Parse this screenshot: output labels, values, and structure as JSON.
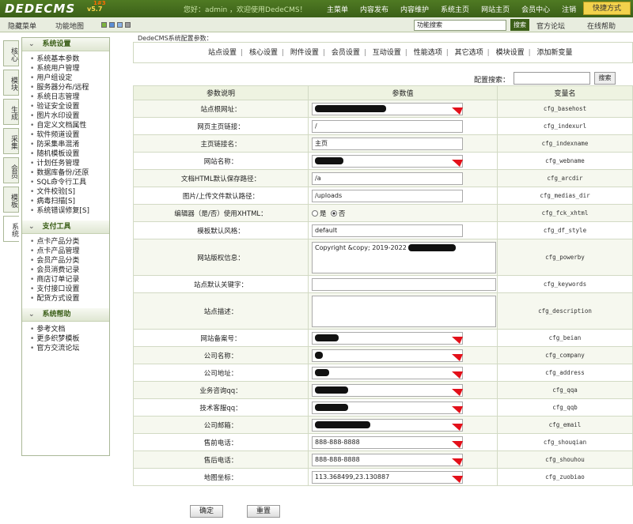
{
  "header": {
    "logo": "DEDECMS",
    "version": "v5.7",
    "badge": "1#3",
    "greeting": "您好：admin ，欢迎使用DedeCMS！",
    "nav": [
      "主菜单",
      "内容发布",
      "内容维护",
      "系统主页",
      "网站主页",
      "会员中心",
      "注销"
    ],
    "shortcut": "快捷方式"
  },
  "subbar": {
    "hide_menu": "隐藏菜单",
    "site_map": "功能地图",
    "search_value": "功能搜索",
    "search_button": "搜索",
    "forum": "官方论坛",
    "help": "在线帮助"
  },
  "vtabs": [
    "核心",
    "模块",
    "生成",
    "采集",
    "会员",
    "模板",
    "系统"
  ],
  "sidebar": {
    "sections": [
      {
        "title": "系统设置",
        "items": [
          "系统基本参数",
          "系统用户管理",
          "用户组设定",
          "服务器分布/远程",
          "系统日志管理",
          "验证安全设置",
          "图片水印设置",
          "自定义文档属性",
          "软件频道设置",
          "防采集串混淆",
          "随机模板设置",
          "计划任务管理",
          "数据库备份/还原",
          "SQL命令行工具",
          "文件校验[S]",
          "病毒扫描[S]",
          "系统错误修复[S]"
        ]
      },
      {
        "title": "支付工具",
        "items": [
          "点卡产品分类",
          "点卡产品管理",
          "会员产品分类",
          "会员消费记录",
          "商店订单记录",
          "支付接口设置",
          "配货方式设置"
        ]
      },
      {
        "title": "系统帮助",
        "items": [
          "参考文档",
          "更多织梦模板",
          "官方交流论坛"
        ]
      }
    ]
  },
  "main": {
    "breadcrumb": "DedeCMS系统配置参数：",
    "tabs": [
      "站点设置",
      "核心设置",
      "附件设置",
      "会员设置",
      "互动设置",
      "性能选项",
      "其它选项",
      "模块设置",
      "添加新变量"
    ],
    "search_label": "配置搜索：",
    "search_button": "搜索",
    "columns": [
      "参数说明",
      "参数值",
      "变量名"
    ],
    "rows": [
      {
        "label": "站点根网址：",
        "value": "",
        "var": "cfg_basehost"
      },
      {
        "label": "网页主页链接：",
        "value": "/",
        "var": "cfg_indexurl"
      },
      {
        "label": "主页链接名：",
        "value": "主页",
        "var": "cfg_indexname"
      },
      {
        "label": "网站名称：",
        "value": "",
        "var": "cfg_webname"
      },
      {
        "label": "文档HTML默认保存路径：",
        "value": "/a",
        "var": "cfg_arcdir"
      },
      {
        "label": "图片/上传文件默认路径：",
        "value": "/uploads",
        "var": "cfg_medias_dir"
      },
      {
        "label": "编辑器（是/否）使用XHTML：",
        "value": "",
        "var": "cfg_fck_xhtml",
        "radio_yes": "是",
        "radio_no": "否"
      },
      {
        "label": "模板默认风格：",
        "value": "default",
        "var": "cfg_df_style"
      },
      {
        "label": "网站版权信息：",
        "value": "Copyright &copy; 2019-2022",
        "var": "cfg_powerby"
      },
      {
        "label": "站点默认关键字：",
        "value": "",
        "var": "cfg_keywords"
      },
      {
        "label": "站点描述：",
        "value": "",
        "var": "cfg_description"
      },
      {
        "label": "网站备案号：",
        "value": "",
        "var": "cfg_beian"
      },
      {
        "label": "公司名称：",
        "value": "",
        "var": "cfg_company"
      },
      {
        "label": "公司地址：",
        "value": "",
        "var": "cfg_address"
      },
      {
        "label": "业务咨询qq：",
        "value": "",
        "var": "cfg_qqa"
      },
      {
        "label": "技术客服qq：",
        "value": "",
        "var": "cfg_qqb"
      },
      {
        "label": "公司邮箱：",
        "value": "",
        "var": "cfg_email"
      },
      {
        "label": "售前电话：",
        "value": "888-888-8888",
        "var": "cfg_shouqian"
      },
      {
        "label": "售后电话：",
        "value": "888-888-8888",
        "var": "cfg_shouhou"
      },
      {
        "label": "地图坐标：",
        "value": "113.368499,23.130887",
        "var": "cfg_zuobiao"
      }
    ],
    "confirm": "确定",
    "reset": "重置"
  },
  "colors": {
    "header": "#3b5f18",
    "accent_flag": "#e3101a",
    "shortcut": "#f3d24c"
  }
}
